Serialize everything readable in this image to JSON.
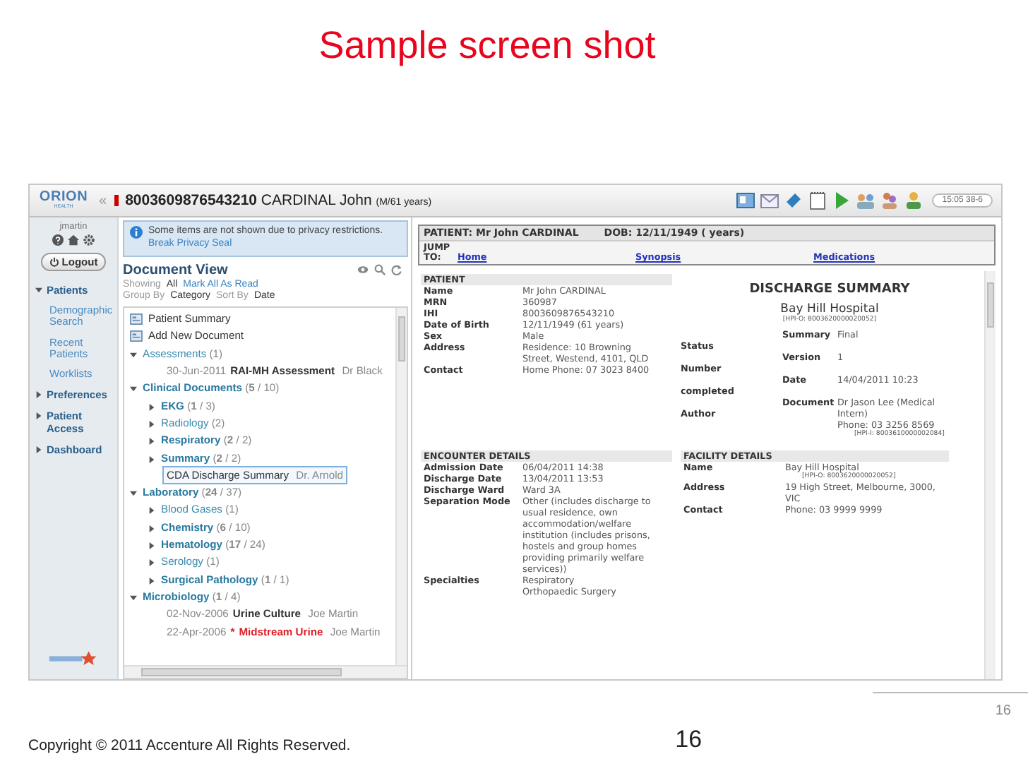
{
  "slide": {
    "title": "Sample screen shot",
    "corner_number": "16",
    "copyright": "Copyright © 2011 Accenture All Rights Reserved.",
    "page_number": "16"
  },
  "app": {
    "header": {
      "logo": "ORION",
      "logo_sub": "HEALTH",
      "collapse": "«",
      "patient_id": "8003609876543210",
      "patient_name": "CARDINAL John",
      "patient_info": "(M/61 years)",
      "clock": "15:05 38-6"
    },
    "sidebar": {
      "user": "jmartin",
      "logout": "Logout",
      "items": [
        {
          "label": "Patients",
          "expanded": true,
          "children": [
            "Demographic Search",
            "Recent Patients",
            "Worklists"
          ]
        },
        {
          "label": "Preferences",
          "expanded": false
        },
        {
          "label": "Patient Access",
          "expanded": false
        },
        {
          "label": "Dashboard",
          "expanded": false
        }
      ]
    },
    "notice": {
      "text": "Some items are not shown due to privacy restrictions.",
      "link": "Break Privacy Seal"
    },
    "document_view": {
      "title": "Document View",
      "showing_label": "Showing",
      "showing_value": "All",
      "mark_all": "Mark All As Read",
      "group_by_label": "Group By",
      "group_by_value": "Category",
      "sort_by_label": "Sort By",
      "sort_by_value": "Date",
      "tree": [
        {
          "kind": "action",
          "label": "Patient Summary"
        },
        {
          "kind": "action",
          "label": "Add New Document"
        },
        {
          "kind": "folder",
          "label": "Assessments",
          "count": "(1)",
          "has_unread": false,
          "expanded": true,
          "children": [
            {
              "kind": "document",
              "date": "30-Jun-2011",
              "title": "RAI-MH Assessment",
              "author": "Dr Black",
              "urgent": false,
              "selected": false
            }
          ]
        },
        {
          "kind": "folder",
          "label": "Clinical Documents",
          "count": "(**5** / 10)",
          "has_unread": true,
          "expanded": true,
          "children": [
            {
              "kind": "folder",
              "label": "EKG",
              "count": "(**1** / 3)",
              "has_unread": true,
              "expanded": false
            },
            {
              "kind": "folder",
              "label": "Radiology",
              "count": "(2)",
              "has_unread": false,
              "expanded": false
            },
            {
              "kind": "folder",
              "label": "Respiratory",
              "count": "(**2** / 2)",
              "has_unread": true,
              "expanded": false
            },
            {
              "kind": "folder",
              "label": "Summary",
              "count": "(**2** / 2)",
              "has_unread": true,
              "expanded": false
            },
            {
              "kind": "document",
              "title": "CDA Discharge Summary",
              "author": "Dr. Arnold",
              "urgent": false,
              "selected": true
            }
          ]
        },
        {
          "kind": "folder",
          "label": "Laboratory",
          "count": "(**24** / 37)",
          "has_unread": true,
          "expanded": true,
          "children": [
            {
              "kind": "folder",
              "label": "Blood Gases",
              "count": "(1)",
              "has_unread": false,
              "expanded": false
            },
            {
              "kind": "folder",
              "label": "Chemistry",
              "count": "(**6** / 10)",
              "has_unread": true,
              "expanded": false
            },
            {
              "kind": "folder",
              "label": "Hematology",
              "count": "(**17** / 24)",
              "has_unread": true,
              "expanded": false
            },
            {
              "kind": "folder",
              "label": "Serology",
              "count": "(1)",
              "has_unread": false,
              "expanded": false
            },
            {
              "kind": "folder",
              "label": "Surgical Pathology",
              "count": "(**1** / 1)",
              "has_unread": true,
              "expanded": false
            }
          ]
        },
        {
          "kind": "folder",
          "label": "Microbiology",
          "count": "(**1** / 4)",
          "has_unread": true,
          "expanded": true,
          "children": [
            {
              "kind": "document",
              "date": "02-Nov-2006",
              "title": "Urine Culture",
              "author": "Joe Martin",
              "urgent": false,
              "selected": false
            },
            {
              "kind": "document",
              "date": "22-Apr-2006",
              "marker": "*",
              "title": "Midstream Urine",
              "author": "Joe Martin",
              "urgent": true,
              "selected": false
            }
          ]
        }
      ]
    },
    "patient_banner": {
      "patient": "PATIENT: Mr John CARDINAL",
      "dob": "DOB: 12/11/1949 ( years)",
      "jump_label": "JUMP TO:",
      "links": [
        "Home",
        "Synopsis",
        "Medications"
      ]
    },
    "patient": {
      "heading": "PATIENT",
      "fields": [
        {
          "label": "Name",
          "lines": [
            "Mr John CARDINAL"
          ]
        },
        {
          "label": "MRN",
          "lines": [
            "360987"
          ]
        },
        {
          "label": "IHI",
          "lines": [
            "8003609876543210"
          ]
        },
        {
          "label": "Date of Birth",
          "lines": [
            "12/11/1949 (61 years)"
          ]
        },
        {
          "label": "Sex",
          "lines": [
            "Male"
          ]
        },
        {
          "label": "Address",
          "lines": [
            "Residence: 10 Browning Street, Westend, 4101, QLD"
          ]
        },
        {
          "label": "Contact",
          "lines": [
            "Home Phone: 07 3023 8400"
          ]
        }
      ]
    },
    "discharge": {
      "title": "DISCHARGE SUMMARY",
      "facility": "Bay Hill Hospital",
      "facility_id": "[HPI-O: 8003620000020052]",
      "side_labels": [
        "Status",
        "Number",
        "completed",
        "Author"
      ],
      "fields": [
        {
          "label": "Summary",
          "lines": [
            "Final"
          ]
        },
        {
          "label": "Version",
          "lines": [
            "1"
          ]
        },
        {
          "label": "Date",
          "lines": [
            "14/04/2011 10:23"
          ]
        },
        {
          "label": "Document",
          "lines": [
            "Dr Jason Lee (Medical Intern)",
            "Phone: 03 3256 8569"
          ],
          "note": "[HPI-I: 8003610000002084]"
        }
      ]
    },
    "encounter": {
      "heading": "ENCOUNTER DETAILS",
      "fields": [
        {
          "label": "Admission Date",
          "lines": [
            "06/04/2011 14:38"
          ]
        },
        {
          "label": "Discharge Date",
          "lines": [
            "13/04/2011 13:53"
          ]
        },
        {
          "label": "Discharge Ward",
          "lines": [
            "Ward 3A"
          ]
        },
        {
          "label": "Separation Mode",
          "lines": [
            "Other (includes discharge to usual residence, own accommodation/welfare institution (includes prisons, hostels and group homes providing primarily welfare services))"
          ]
        },
        {
          "label": "Specialties",
          "lines": [
            "Respiratory",
            "Orthopaedic Surgery"
          ]
        }
      ]
    },
    "facility": {
      "heading": "FACILITY DETAILS",
      "fields": [
        {
          "label": "Name",
          "lines": [
            "Bay Hill Hospital"
          ],
          "note": "[HPI-O: 8003620000020052]"
        },
        {
          "label": "Address",
          "lines": [
            "19 High Street, Melbourne, 3000, VIC"
          ]
        },
        {
          "label": "Contact",
          "lines": [
            "Phone: 03 9999 9999"
          ]
        }
      ]
    }
  }
}
